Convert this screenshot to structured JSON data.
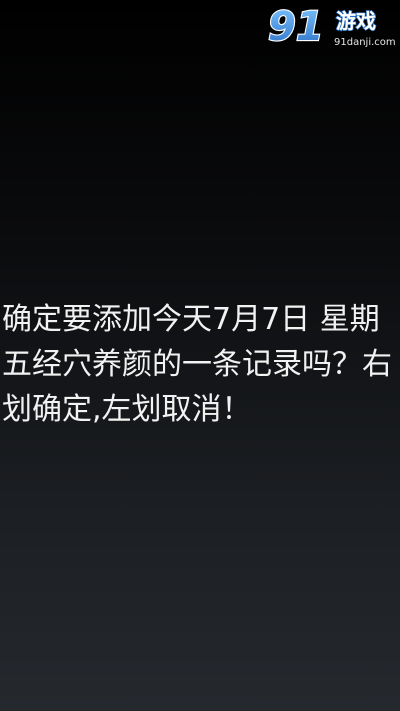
{
  "watermark": {
    "logo_number": "91",
    "logo_text": "游戏",
    "logo_domain": "91danji.com"
  },
  "prompt": {
    "message": "确定要添加今天7月7日 星期五经穴养颜的一条记录吗？右划确定,左划取消！"
  },
  "colors": {
    "text": "#f2f2f2",
    "background_top": "#000000",
    "background_bottom": "#25292e",
    "logo_blue": "#3a86d6"
  }
}
